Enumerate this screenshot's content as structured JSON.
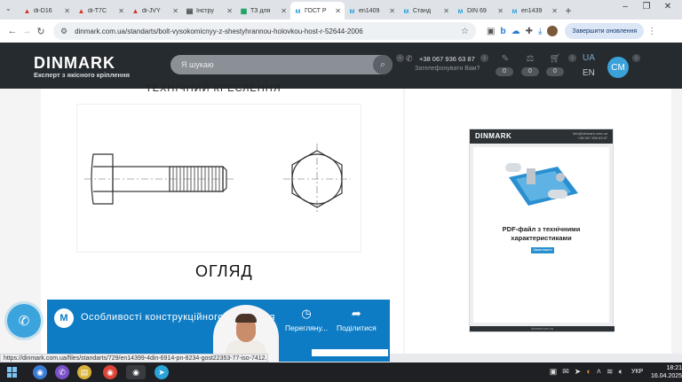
{
  "browser": {
    "tabs": [
      {
        "label": "di-D16",
        "icon": "▲",
        "color": "#d93025"
      },
      {
        "label": "di-T7C",
        "icon": "▲",
        "color": "#d93025"
      },
      {
        "label": "di-JVY",
        "icon": "▲",
        "color": "#d93025"
      },
      {
        "label": "Інстру",
        "icon": "▤",
        "color": "#333333"
      },
      {
        "label": "ТЗ для",
        "icon": "▦",
        "color": "#0f9d58"
      },
      {
        "label": "ГОСТ Р",
        "icon": "ᴍ",
        "color": "#2ea1dc"
      },
      {
        "label": "en1409",
        "icon": "ᴍ",
        "color": "#2ea1dc"
      },
      {
        "label": "Станд",
        "icon": "ᴍ",
        "color": "#2ea1dc"
      },
      {
        "label": "DIN 69",
        "icon": "ᴍ",
        "color": "#2ea1dc"
      },
      {
        "label": "en1439",
        "icon": "ᴍ",
        "color": "#2ea1dc"
      }
    ],
    "active_tab_index": 5,
    "url": "dinmark.com.ua/standarts/bolt-vysokomicnyy-z-shestyhrannou-holovkou-host-r-52644-2006",
    "finish_update_label": "Завершити оновлення"
  },
  "site": {
    "logo": "DINMARK",
    "tagline": "Експерт з якісного кріплення",
    "search_placeholder": "Я шукаю",
    "phone": "+38 067 936 63 87",
    "callback": "Зателефонувати Вам?",
    "counters": [
      "0",
      "0",
      "0"
    ],
    "lang_ua": "UA",
    "lang_en": "EN",
    "cm_label": "CM"
  },
  "content": {
    "heading_cut": "ТЕХНІЧНИЙ КРЕСЛЕННЯ",
    "overview_label": "ОГЛЯД",
    "video": {
      "title": "Особливості конструкційного кріплення",
      "watch_later": "Переглянy...",
      "share": "Поділитися"
    },
    "pdf_promo": {
      "logo": "DINMARK",
      "email": "info@dinmark.com.ua",
      "phone": "+38 067 936 63 87",
      "title": "PDF-файл з технічними характеристиками",
      "button": "Завантажити",
      "footer": "dinmark.com.ua"
    }
  },
  "status_url": "https://dinmark.com.ua/files/standarts/729/en14399-4din-6914-pn-8234-gost22353-77-iso-7412.pdf",
  "taskbar": {
    "lang": "УКР",
    "time": "18:21",
    "date": "16.04.2025"
  }
}
